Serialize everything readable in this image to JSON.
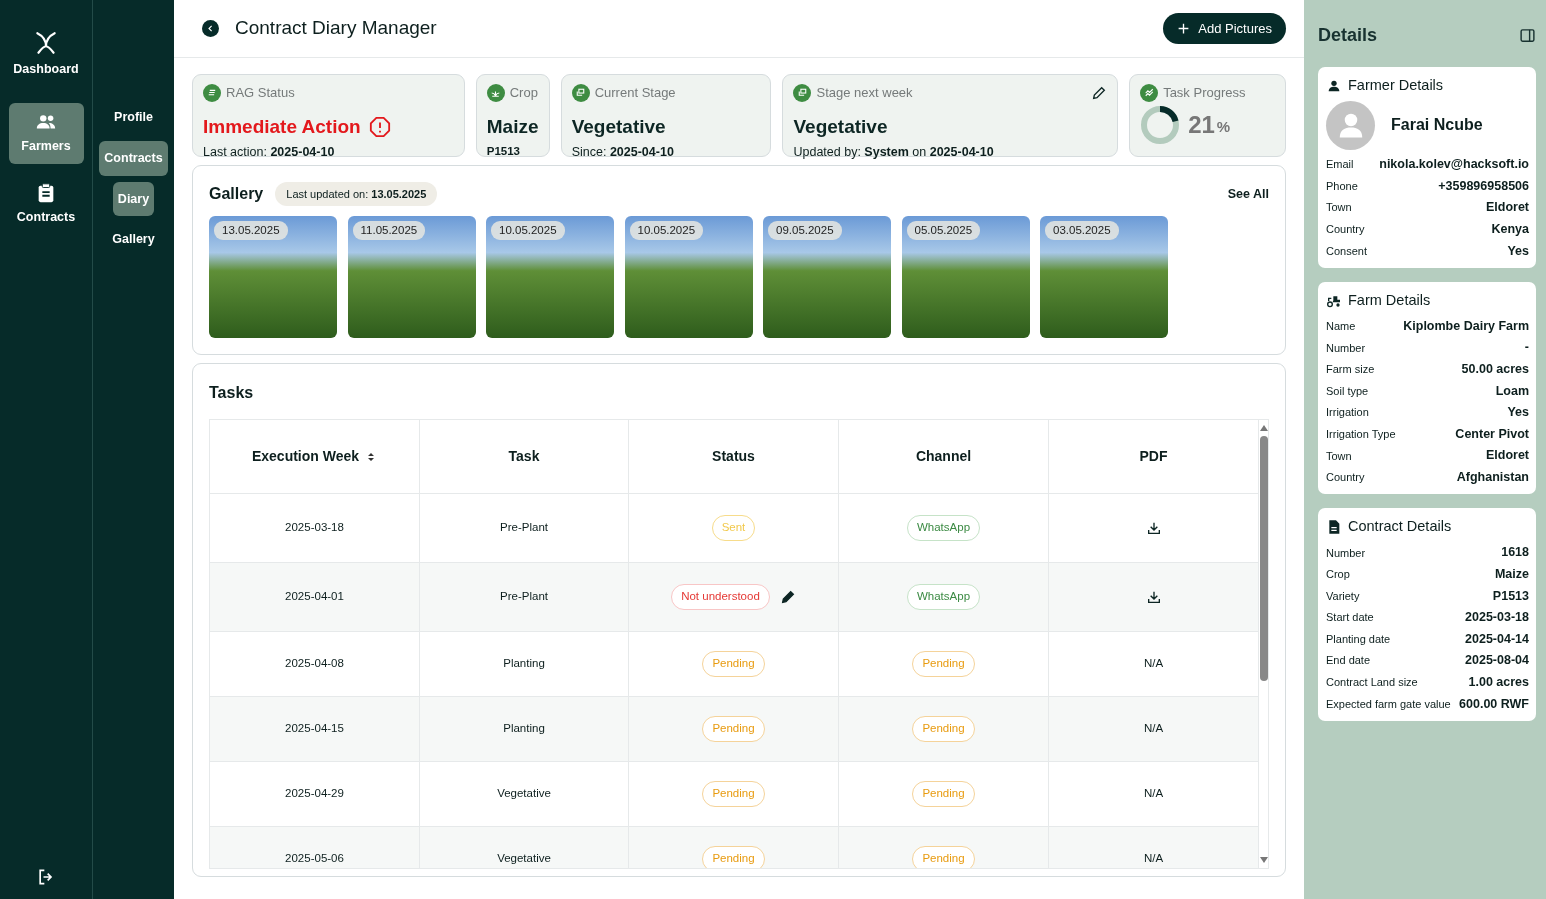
{
  "main_nav": [
    {
      "label": "Dashboard",
      "selected": false
    },
    {
      "label": "Farmers",
      "selected": true
    },
    {
      "label": "Contracts",
      "selected": false
    }
  ],
  "sub_nav": [
    {
      "label": "Profile",
      "selected": false
    },
    {
      "label": "Contracts",
      "selected": true
    },
    {
      "label": "Diary",
      "selected": true
    },
    {
      "label": "Gallery",
      "selected": false
    }
  ],
  "header": {
    "title": "Contract Diary Manager",
    "action": "Add Pictures"
  },
  "summary_cards": [
    {
      "kind": "rag",
      "title": "RAG Status",
      "value": "Immediate Action",
      "sub": "Last action: **2025-04-10**"
    },
    {
      "kind": "crop",
      "title": "Crop",
      "value": "Maize",
      "sub": "**P1513**"
    },
    {
      "kind": "stage",
      "title": "Current Stage",
      "value": "Vegetative",
      "sub": "Since: **2025-04-10**"
    },
    {
      "kind": "next",
      "title": "Stage next week",
      "value": "Vegetative",
      "sub": "Updated by: **System** on **2025-04-10**"
    },
    {
      "kind": "progress",
      "title": "Task Progress",
      "value": "21",
      "unit": "%",
      "level": 0.21
    }
  ],
  "gallery": {
    "title": "Gallery",
    "updated": "Last updated on: **13.05.2025**",
    "see_all": "See All",
    "photos": [
      "13.05.2025",
      "11.05.2025",
      "10.05.2025",
      "10.05.2025",
      "09.05.2025",
      "05.05.2025",
      "03.05.2025"
    ]
  },
  "tasks": {
    "title": "Tasks",
    "columns": [
      "Execution Week",
      "Task",
      "Status",
      "Channel",
      "PDF"
    ],
    "rows": [
      {
        "week": "2025-03-18",
        "task": "Pre-Plant",
        "status": {
          "label": "Sent",
          "kind": "sent"
        },
        "channel": {
          "label": "WhatsApp",
          "kind": "whatsapp"
        },
        "pdf": {
          "kind": "download"
        }
      },
      {
        "week": "2025-04-01",
        "task": "Pre-Plant",
        "status": {
          "label": "Not understood",
          "kind": "error_editable"
        },
        "channel": {
          "label": "WhatsApp",
          "kind": "whatsapp"
        },
        "pdf": {
          "kind": "download"
        }
      },
      {
        "week": "2025-04-08",
        "task": "Planting",
        "status": {
          "label": "Pending",
          "kind": "pending"
        },
        "channel": {
          "label": "Pending",
          "kind": "pending"
        },
        "pdf": {
          "kind": "text",
          "label": "N/A"
        }
      },
      {
        "week": "2025-04-15",
        "task": "Planting",
        "status": {
          "label": "Pending",
          "kind": "pending"
        },
        "channel": {
          "label": "Pending",
          "kind": "pending"
        },
        "pdf": {
          "kind": "text",
          "label": "N/A"
        }
      },
      {
        "week": "2025-04-29",
        "task": "Vegetative",
        "status": {
          "label": "Pending",
          "kind": "pending"
        },
        "channel": {
          "label": "Pending",
          "kind": "pending"
        },
        "pdf": {
          "kind": "text",
          "label": "N/A"
        }
      },
      {
        "week": "2025-05-06",
        "task": "Vegetative",
        "status": {
          "label": "Pending",
          "kind": "pending"
        },
        "channel": {
          "label": "Pending",
          "kind": "pending"
        },
        "pdf": {
          "kind": "text",
          "label": "N/A"
        }
      }
    ]
  },
  "details": {
    "title": "Details",
    "sections": [
      {
        "kind": "farmer",
        "title": "Farmer Details",
        "name": "Farai Ncube",
        "fields": [
          [
            "Email",
            "nikola.kolev@hacksoft.io"
          ],
          [
            "Phone",
            "+359896958506"
          ],
          [
            "Town",
            "Eldoret"
          ],
          [
            "Country",
            "Kenya"
          ],
          [
            "Consent",
            "Yes"
          ]
        ]
      },
      {
        "kind": "farm",
        "title": "Farm Details",
        "fields": [
          [
            "Name",
            "Kiplombe Dairy Farm"
          ],
          [
            "Number",
            "-"
          ],
          [
            "Farm size",
            "50.00 acres"
          ],
          [
            "Soil type",
            "Loam"
          ],
          [
            "Irrigation",
            "Yes"
          ],
          [
            "Irrigation Type",
            "Center Pivot"
          ],
          [
            "Town",
            "Eldoret"
          ],
          [
            "Country",
            "Afghanistan"
          ]
        ]
      },
      {
        "kind": "contract",
        "title": "Contract Details",
        "fields": [
          [
            "Number",
            "1618"
          ],
          [
            "Crop",
            "Maize"
          ],
          [
            "Variety",
            "P1513"
          ],
          [
            "Start date",
            "2025-03-18"
          ],
          [
            "Planting date",
            "2025-04-14"
          ],
          [
            "End date",
            "2025-08-04"
          ],
          [
            "Contract Land size",
            "1.00 acres"
          ],
          [
            "Expected farm gate value",
            "600.00 RWF"
          ]
        ]
      }
    ]
  }
}
